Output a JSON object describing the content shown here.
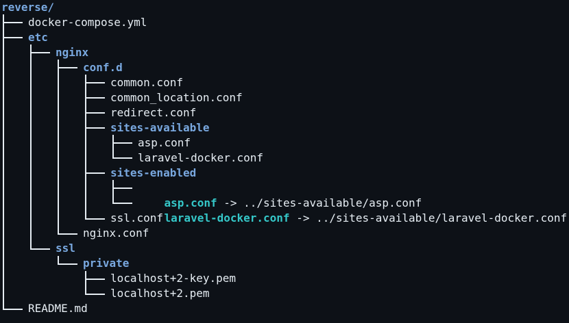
{
  "tree": {
    "root": "reverse/",
    "entries": [
      {
        "name": "docker-compose.yml",
        "type": "file"
      },
      {
        "name": "etc",
        "type": "dir"
      },
      {
        "name": "nginx",
        "type": "dir"
      },
      {
        "name": "conf.d",
        "type": "dir"
      },
      {
        "name": "common.conf",
        "type": "file"
      },
      {
        "name": "common_location.conf",
        "type": "file"
      },
      {
        "name": "redirect.conf",
        "type": "file"
      },
      {
        "name": "sites-available",
        "type": "dir"
      },
      {
        "name": "asp.conf",
        "type": "file"
      },
      {
        "name": "laravel-docker.conf",
        "type": "file"
      },
      {
        "name": "sites-enabled",
        "type": "dir"
      },
      {
        "name": "asp.conf",
        "type": "symlink",
        "arrow": "->",
        "target": "../sites-available/asp.conf"
      },
      {
        "name": "laravel-docker.conf",
        "type": "symlink",
        "arrow": "->",
        "target": "../sites-available/laravel-docker.conf"
      },
      {
        "name": "ssl.conf",
        "type": "file"
      },
      {
        "name": "nginx.conf",
        "type": "file"
      },
      {
        "name": "ssl",
        "type": "dir"
      },
      {
        "name": "private",
        "type": "dir"
      },
      {
        "name": "localhost+2-key.pem",
        "type": "file"
      },
      {
        "name": "localhost+2.pem",
        "type": "file"
      },
      {
        "name": "README.md",
        "type": "file"
      }
    ]
  },
  "colors": {
    "background": "#0d1117",
    "directory": "#79a8df",
    "symlink": "#35c7c8",
    "file": "#e6edf3",
    "tree_lines": "#e6edf3"
  }
}
